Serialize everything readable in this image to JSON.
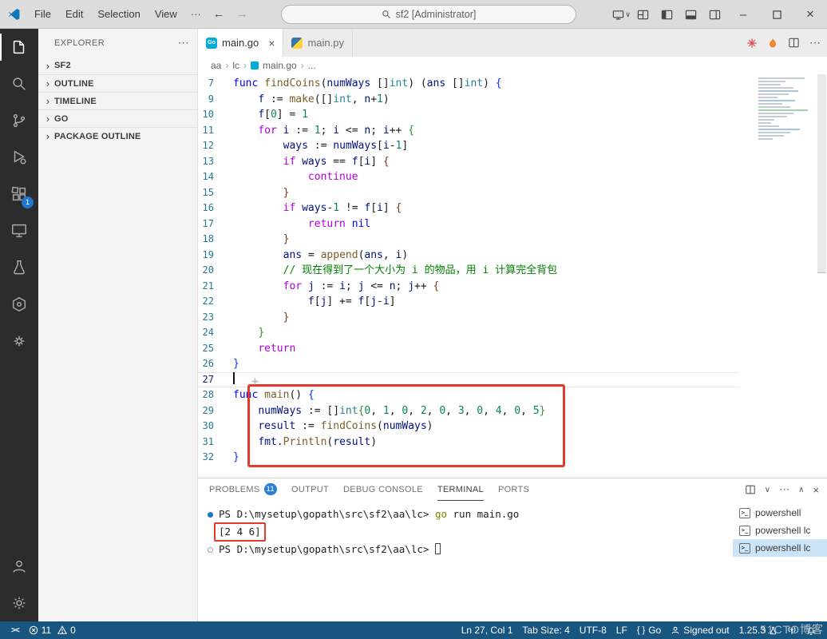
{
  "icons": {
    "chevron_right": "›",
    "close": "×",
    "more": "⋯",
    "more_h": "···",
    "back_arrow": "←",
    "forward_arrow": "→",
    "minimize": "–",
    "chevron_down": "∨",
    "chevron_up": "∧",
    "go_file_glyph": "Go",
    "ps_glyph": ">_"
  },
  "title_bar": {
    "menus": [
      "File",
      "Edit",
      "Selection",
      "View"
    ],
    "search_text": "sf2 [Administrator]"
  },
  "activity_bar": {
    "extensions_badge": "1"
  },
  "explorer": {
    "title": "EXPLORER",
    "sections": [
      {
        "label": "SF2"
      },
      {
        "label": "OUTLINE"
      },
      {
        "label": "TIMELINE"
      },
      {
        "label": "GO"
      },
      {
        "label": "PACKAGE OUTLINE"
      }
    ]
  },
  "editor": {
    "tabs": [
      {
        "label": "main.go",
        "icon": "go",
        "active": true
      },
      {
        "label": "main.py",
        "icon": "python",
        "active": false
      }
    ],
    "breadcrumb": [
      "aa",
      "lc",
      "main.go",
      "..."
    ],
    "cursor_line": 27,
    "code_lines": [
      {
        "n": 7,
        "t": [
          [
            "kb",
            "func"
          ],
          [
            "pl",
            " "
          ],
          [
            "fn",
            "findCoins"
          ],
          [
            "pl",
            "("
          ],
          [
            "vr",
            "numWays"
          ],
          [
            "pl",
            " []"
          ],
          [
            "ty",
            "int"
          ],
          [
            "pl",
            ") ("
          ],
          [
            "vr",
            "ans"
          ],
          [
            "pl",
            " []"
          ],
          [
            "ty",
            "int"
          ],
          [
            "pl",
            ") "
          ],
          [
            "b1",
            "{"
          ]
        ]
      },
      {
        "n": 9,
        "t": [
          [
            "pl",
            "    "
          ],
          [
            "vr",
            "f"
          ],
          [
            "pl",
            " := "
          ],
          [
            "fn",
            "make"
          ],
          [
            "pl",
            "([]"
          ],
          [
            "ty",
            "int"
          ],
          [
            "pl",
            ", "
          ],
          [
            "vr",
            "n"
          ],
          [
            "pl",
            "+"
          ],
          [
            "nu",
            "1"
          ],
          [
            "pl",
            ")"
          ]
        ]
      },
      {
        "n": 10,
        "t": [
          [
            "pl",
            "    "
          ],
          [
            "vr",
            "f"
          ],
          [
            "pl",
            "["
          ],
          [
            "nu",
            "0"
          ],
          [
            "pl",
            "] = "
          ],
          [
            "nu",
            "1"
          ]
        ]
      },
      {
        "n": 11,
        "t": [
          [
            "pl",
            "    "
          ],
          [
            "kc",
            "for"
          ],
          [
            "pl",
            " "
          ],
          [
            "vr",
            "i"
          ],
          [
            "pl",
            " := "
          ],
          [
            "nu",
            "1"
          ],
          [
            "pl",
            "; "
          ],
          [
            "vr",
            "i"
          ],
          [
            "pl",
            " <= "
          ],
          [
            "vr",
            "n"
          ],
          [
            "pl",
            "; "
          ],
          [
            "vr",
            "i"
          ],
          [
            "pl",
            "++ "
          ],
          [
            "b2",
            "{"
          ]
        ]
      },
      {
        "n": 12,
        "t": [
          [
            "pl",
            "        "
          ],
          [
            "vr",
            "ways"
          ],
          [
            "pl",
            " := "
          ],
          [
            "vr",
            "numWays"
          ],
          [
            "pl",
            "["
          ],
          [
            "vr",
            "i"
          ],
          [
            "pl",
            "-"
          ],
          [
            "nu",
            "1"
          ],
          [
            "pl",
            "]"
          ]
        ]
      },
      {
        "n": 13,
        "t": [
          [
            "pl",
            "        "
          ],
          [
            "kc",
            "if"
          ],
          [
            "pl",
            " "
          ],
          [
            "vr",
            "ways"
          ],
          [
            "pl",
            " == "
          ],
          [
            "vr",
            "f"
          ],
          [
            "pl",
            "["
          ],
          [
            "vr",
            "i"
          ],
          [
            "pl",
            "] "
          ],
          [
            "b3",
            "{"
          ]
        ]
      },
      {
        "n": 14,
        "t": [
          [
            "pl",
            "            "
          ],
          [
            "kc",
            "continue"
          ]
        ]
      },
      {
        "n": 15,
        "t": [
          [
            "pl",
            "        "
          ],
          [
            "b3",
            "}"
          ]
        ]
      },
      {
        "n": 16,
        "t": [
          [
            "pl",
            "        "
          ],
          [
            "kc",
            "if"
          ],
          [
            "pl",
            " "
          ],
          [
            "vr",
            "ways"
          ],
          [
            "pl",
            "-"
          ],
          [
            "nu",
            "1"
          ],
          [
            "pl",
            " != "
          ],
          [
            "vr",
            "f"
          ],
          [
            "pl",
            "["
          ],
          [
            "vr",
            "i"
          ],
          [
            "pl",
            "] "
          ],
          [
            "b3",
            "{"
          ]
        ]
      },
      {
        "n": 17,
        "t": [
          [
            "pl",
            "            "
          ],
          [
            "kc",
            "return"
          ],
          [
            "pl",
            " "
          ],
          [
            "kb",
            "nil"
          ]
        ]
      },
      {
        "n": 18,
        "t": [
          [
            "pl",
            "        "
          ],
          [
            "b3",
            "}"
          ]
        ]
      },
      {
        "n": 19,
        "t": [
          [
            "pl",
            "        "
          ],
          [
            "vr",
            "ans"
          ],
          [
            "pl",
            " = "
          ],
          [
            "fn",
            "append"
          ],
          [
            "pl",
            "("
          ],
          [
            "vr",
            "ans"
          ],
          [
            "pl",
            ", "
          ],
          [
            "vr",
            "i"
          ],
          [
            "pl",
            ")"
          ]
        ]
      },
      {
        "n": 20,
        "t": [
          [
            "pl",
            "        "
          ],
          [
            "cm",
            "// 现在得到了一个大小为 i 的物品，用 i 计算完全背包"
          ]
        ]
      },
      {
        "n": 21,
        "t": [
          [
            "pl",
            "        "
          ],
          [
            "kc",
            "for"
          ],
          [
            "pl",
            " "
          ],
          [
            "vr",
            "j"
          ],
          [
            "pl",
            " := "
          ],
          [
            "vr",
            "i"
          ],
          [
            "pl",
            "; "
          ],
          [
            "vr",
            "j"
          ],
          [
            "pl",
            " <= "
          ],
          [
            "vr",
            "n"
          ],
          [
            "pl",
            "; "
          ],
          [
            "vr",
            "j"
          ],
          [
            "pl",
            "++ "
          ],
          [
            "b3",
            "{"
          ]
        ]
      },
      {
        "n": 22,
        "t": [
          [
            "pl",
            "            "
          ],
          [
            "vr",
            "f"
          ],
          [
            "pl",
            "["
          ],
          [
            "vr",
            "j"
          ],
          [
            "pl",
            "] += "
          ],
          [
            "vr",
            "f"
          ],
          [
            "pl",
            "["
          ],
          [
            "vr",
            "j"
          ],
          [
            "pl",
            "-"
          ],
          [
            "vr",
            "i"
          ],
          [
            "pl",
            "]"
          ]
        ]
      },
      {
        "n": 23,
        "t": [
          [
            "pl",
            "        "
          ],
          [
            "b3",
            "}"
          ]
        ]
      },
      {
        "n": 24,
        "t": [
          [
            "pl",
            "    "
          ],
          [
            "b2",
            "}"
          ]
        ]
      },
      {
        "n": 25,
        "t": [
          [
            "pl",
            "    "
          ],
          [
            "kc",
            "return"
          ]
        ]
      },
      {
        "n": 26,
        "t": [
          [
            "b1",
            "}"
          ]
        ]
      },
      {
        "n": 27,
        "cursor": true,
        "t": []
      },
      {
        "n": 28,
        "t": [
          [
            "kb",
            "func"
          ],
          [
            "pl",
            " "
          ],
          [
            "fn",
            "main"
          ],
          [
            "pl",
            "() "
          ],
          [
            "b1",
            "{"
          ]
        ]
      },
      {
        "n": 29,
        "t": [
          [
            "pl",
            "    "
          ],
          [
            "vr",
            "numWays"
          ],
          [
            "pl",
            " := []"
          ],
          [
            "ty",
            "int"
          ],
          [
            "b2",
            "{"
          ],
          [
            "nu",
            "0"
          ],
          [
            "pl",
            ", "
          ],
          [
            "nu",
            "1"
          ],
          [
            "pl",
            ", "
          ],
          [
            "nu",
            "0"
          ],
          [
            "pl",
            ", "
          ],
          [
            "nu",
            "2"
          ],
          [
            "pl",
            ", "
          ],
          [
            "nu",
            "0"
          ],
          [
            "pl",
            ", "
          ],
          [
            "nu",
            "3"
          ],
          [
            "pl",
            ", "
          ],
          [
            "nu",
            "0"
          ],
          [
            "pl",
            ", "
          ],
          [
            "nu",
            "4"
          ],
          [
            "pl",
            ", "
          ],
          [
            "nu",
            "0"
          ],
          [
            "pl",
            ", "
          ],
          [
            "nu",
            "5"
          ],
          [
            "b2",
            "}"
          ]
        ]
      },
      {
        "n": 30,
        "t": [
          [
            "pl",
            "    "
          ],
          [
            "vr",
            "result"
          ],
          [
            "pl",
            " := "
          ],
          [
            "fn",
            "findCoins"
          ],
          [
            "pl",
            "("
          ],
          [
            "vr",
            "numWays"
          ],
          [
            "pl",
            ")"
          ]
        ]
      },
      {
        "n": 31,
        "t": [
          [
            "pl",
            "    "
          ],
          [
            "vr",
            "fmt"
          ],
          [
            "pl",
            "."
          ],
          [
            "fn",
            "Println"
          ],
          [
            "pl",
            "("
          ],
          [
            "vr",
            "result"
          ],
          [
            "pl",
            ")"
          ]
        ]
      },
      {
        "n": 32,
        "t": [
          [
            "b1",
            "}"
          ]
        ]
      }
    ]
  },
  "panel": {
    "tabs": [
      {
        "label": "PROBLEMS",
        "badge": "11"
      },
      {
        "label": "OUTPUT"
      },
      {
        "label": "DEBUG CONSOLE"
      },
      {
        "label": "TERMINAL",
        "active": true
      },
      {
        "label": "PORTS"
      }
    ],
    "terminal": {
      "lines": [
        {
          "deco": "filled",
          "t": [
            [
              "pr",
              "PS D:\\mysetup\\gopath\\src\\sf2\\aa\\lc> "
            ],
            [
              "cmd",
              "go"
            ],
            [
              "pl",
              " run main.go"
            ]
          ]
        },
        {
          "boxed": true,
          "t": [
            [
              "pl",
              "[2 4 6]"
            ]
          ]
        },
        {
          "deco": "hollow",
          "cursor": true,
          "t": [
            [
              "pr",
              "PS D:\\mysetup\\gopath\\src\\sf2\\aa\\lc> "
            ]
          ]
        }
      ],
      "list": [
        {
          "label": "powershell"
        },
        {
          "label": "powershell lc"
        },
        {
          "label": "powershell lc",
          "selected": true
        }
      ]
    }
  },
  "status_bar": {
    "errors": "11",
    "warnings": "0",
    "line_col": "Ln 27, Col 1",
    "tab_size": "Tab Size: 4",
    "encoding": "UTF-8",
    "eol": "LF",
    "braces": "{ }",
    "language": "Go",
    "account": "Signed out",
    "version": "1.25.3"
  },
  "watermark": "51CTO博客"
}
